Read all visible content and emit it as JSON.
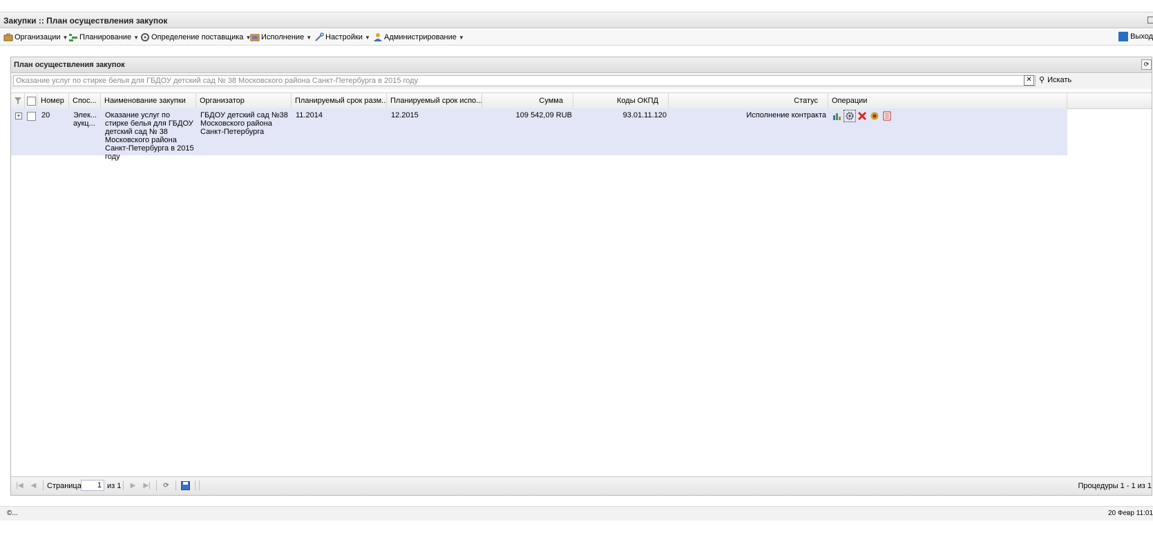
{
  "window": {
    "title": "Закупки :: План осуществления закупок"
  },
  "menu": {
    "items": [
      {
        "label": "Организации",
        "icon": "briefcase-icon"
      },
      {
        "label": "Планирование",
        "icon": "plan-icon"
      },
      {
        "label": "Определение поставщика",
        "icon": "gears-icon"
      },
      {
        "label": "Исполнение",
        "icon": "folders-icon"
      },
      {
        "label": "Настройки",
        "icon": "wrench-icon"
      },
      {
        "label": "Администрирование",
        "icon": "user-icon"
      }
    ],
    "exit_label": "Выход"
  },
  "panel": {
    "title": "План осуществления закупок"
  },
  "search": {
    "value": "Оказание услуг по стирке белья для ГБДОУ детский сад № 38 Московского района Санкт-Петербурга в 2015 году",
    "button_label": "Искать"
  },
  "grid": {
    "columns": [
      "Номер",
      "Спос...",
      "Наименование закупки",
      "Организатор",
      "Планируемый срок разм...",
      "Планируемый срок испо...",
      "Сумма",
      "Коды ОКПД",
      "Статус",
      "Операции"
    ],
    "rows": [
      {
        "number": "20",
        "method": "Элек... аукц...",
        "name": "Оказание услуг по стирке белья для ГБДОУ детский сад № 38 Московского района Санкт-Петербурга в 2015 году",
        "organizer": "ГБДОУ детский сад №38 Московского района Санкт-Петербурга",
        "plan_place": "11.2014",
        "plan_exec": "12.2015",
        "sum": "109 542,09 RUB",
        "okpd": "93.01.11.120",
        "status": "Исполнение контракта",
        "operations": [
          "chart-icon",
          "settings-icon",
          "delete-icon",
          "emblem-icon",
          "document-icon"
        ]
      }
    ]
  },
  "pager": {
    "page_label": "Страница",
    "page_value": "1",
    "of_label": "из 1",
    "info": "Процедуры 1 - 1 из 1"
  },
  "statusbar": {
    "left": "©...",
    "right": "20 Февр 11:01"
  }
}
